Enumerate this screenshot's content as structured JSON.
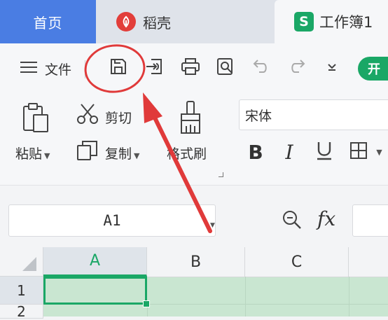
{
  "tabs": {
    "home": "首页",
    "docer": "稻壳",
    "workbook": "工作簿1"
  },
  "quickbar": {
    "file_label": "文件",
    "start_label": "开"
  },
  "ribbon": {
    "paste_label": "粘贴",
    "cut_label": "剪切",
    "copy_label": "复制",
    "format_painter_label": "格式刷",
    "font_name": "宋体"
  },
  "formula_bar": {
    "name_box": "A1",
    "fx": "fx"
  },
  "grid": {
    "columns": [
      "A",
      "B",
      "C"
    ],
    "rows": [
      "1",
      "2"
    ]
  },
  "colors": {
    "accent_green": "#1aa766",
    "home_tab_blue": "#4a7de3",
    "annotation_red": "#e03a3a"
  },
  "icons": {
    "save": "save-icon",
    "undo": "undo-icon",
    "redo": "redo-icon",
    "print": "print-icon",
    "print_preview": "print-preview-icon"
  }
}
